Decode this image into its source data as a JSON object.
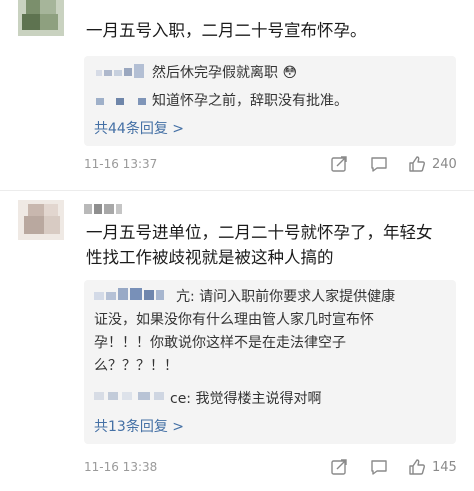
{
  "comments": [
    {
      "text": "一月五号入职，二月二十号宣布怀孕。",
      "replies": [
        {
          "text": "然后休完孕假就离职 😳"
        },
        {
          "text": "知道怀孕之前，辞职没有批准。"
        }
      ],
      "more_replies": "共44条回复 >",
      "timestamp": "11-16 13:37",
      "likes": "240"
    },
    {
      "text_lines": [
        "一月五号进单位，二月二十号就怀孕了，年轻女",
        "性找工作被歧视就是被这种人搞的"
      ],
      "replies": [
        {
          "lines": [
            "亢: 请问入职前你要求人家提供健康",
            "证没，如果没你有什么理由管人家几时宣布怀",
            "孕！！！你敢说你这样不是在走法律空子",
            "么？？？！！"
          ]
        },
        {
          "lines": [
            "ce: 我觉得楼主说得对啊"
          ]
        }
      ],
      "more_replies": "共13条回复 >",
      "timestamp": "11-16 13:38",
      "likes": "145"
    }
  ],
  "icons": [
    "share-icon",
    "comment-icon",
    "like-icon"
  ]
}
